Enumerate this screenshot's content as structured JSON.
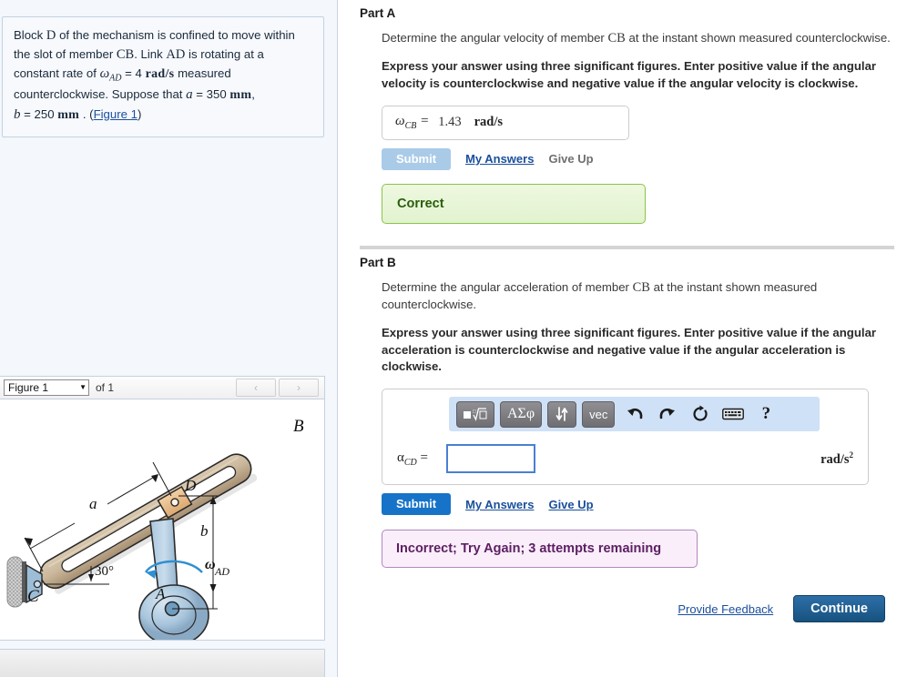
{
  "problem": {
    "line1_a": "Block ",
    "var_D": "D",
    "line1_b": " of the mechanism is confined to move within the slot of member ",
    "var_CB": "CB",
    "line1_c": ". Link ",
    "var_AD": "AD",
    "line1_d": " is rotating at a constant rate of ",
    "omega_sym": "ω",
    "omega_sub": "AD",
    "eq1": " = 4",
    "unit_rads": "rad/s",
    "line1_e": " measured counterclockwise. Suppose that ",
    "var_a": "a",
    "eq_a": " = 350",
    "unit_mm": "mm",
    "comma": ",",
    "var_b": "b",
    "eq_b": " = 250",
    "period": ".",
    "figure_link": "Figure 1"
  },
  "figure_toolbar": {
    "selected": "Figure 1",
    "of_label": "of 1",
    "prev_label": "‹",
    "next_label": "›"
  },
  "figure": {
    "label_B": "B",
    "label_C": "C",
    "label_D": "D",
    "label_A": "A",
    "label_a": "a",
    "label_b": "b",
    "label_angle": "30°",
    "label_omega": "ω",
    "label_omega_sub": "AD"
  },
  "part_a": {
    "title": "Part A",
    "question_1": "Determine the angular velocity of member ",
    "question_var": "CB",
    "question_2": " at the instant shown measured counterclockwise.",
    "instruction": "Express your answer using three significant figures. Enter positive value if the angular velocity is counterclockwise and negative value if the angular velocity is clockwise.",
    "answer_label_sym": "ω",
    "answer_label_sub": "CB",
    "answer_equals": "=",
    "answer_value": "1.43",
    "answer_unit": "rad/s",
    "submit_label": "Submit",
    "my_answers_label": "My Answers",
    "give_up_label": "Give Up",
    "status": "Correct"
  },
  "part_b": {
    "title": "Part B",
    "question_1": "Determine the angular acceleration of member ",
    "question_var": "CB",
    "question_2": " at the instant shown measured counterclockwise.",
    "instruction": "Express your answer using three significant figures. Enter positive value if the angular acceleration is counterclockwise and negative value if the angular acceleration is clockwise.",
    "toolbar": {
      "template_label": "√",
      "greek_label": "ΑΣφ",
      "updown_label": "⇅",
      "vec_label": "vec",
      "undo_label": "↶",
      "redo_label": "↷",
      "reset_label": "↻",
      "keyboard_label": "⌨",
      "help_label": "?"
    },
    "answer_label_sym": "α",
    "answer_label_sub": "CD",
    "answer_equals": "=",
    "answer_value": "",
    "answer_placeholder": "",
    "answer_unit_base": "rad/s",
    "answer_unit_exp": "2",
    "submit_label": "Submit",
    "my_answers_label": "My Answers",
    "give_up_label": "Give Up",
    "status": "Incorrect; Try Again; 3 attempts remaining"
  },
  "footer": {
    "provide_feedback_label": "Provide Feedback",
    "continue_label": "Continue"
  },
  "colors": {
    "accent_blue": "#1673c8",
    "link_blue": "#1a4f9c",
    "correct_green": "#2a5d0c",
    "incorrect_purple": "#5c2063",
    "toolbar_blue": "#cfe1f7"
  }
}
